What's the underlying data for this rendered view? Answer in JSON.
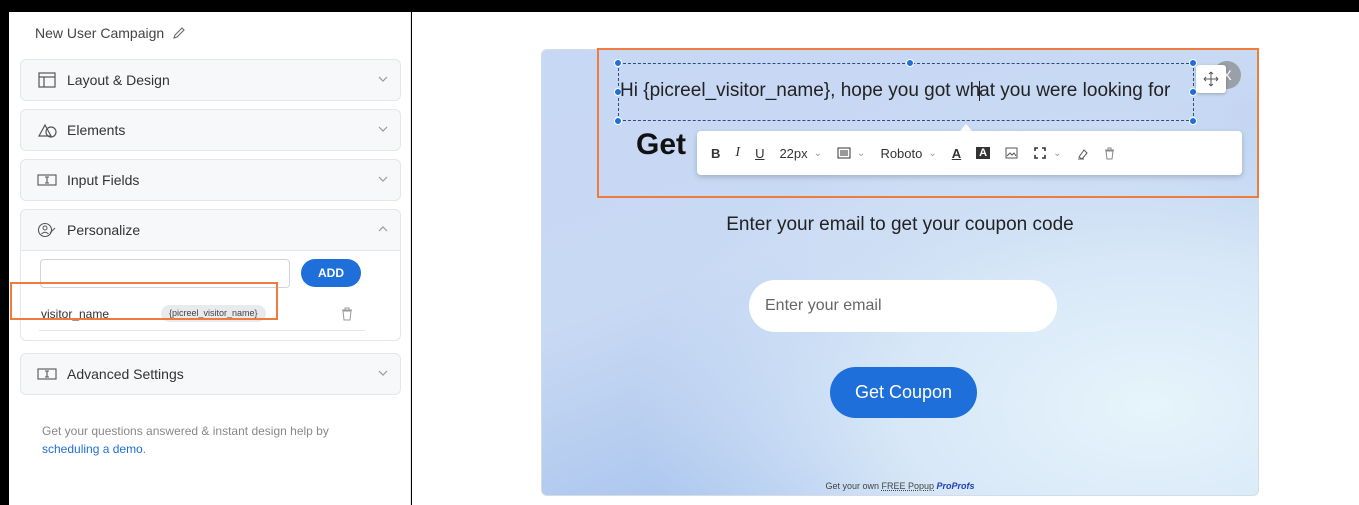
{
  "sidebar": {
    "campaign_title": "New User Campaign",
    "panels": [
      {
        "label": "Layout & Design",
        "icon": "layout-icon",
        "expanded": false
      },
      {
        "label": "Elements",
        "icon": "shapes-icon",
        "expanded": false
      },
      {
        "label": "Input Fields",
        "icon": "input-field-icon",
        "expanded": false
      },
      {
        "label": "Personalize",
        "icon": "personalize-icon",
        "expanded": true
      },
      {
        "label": "Advanced Settings",
        "icon": "settings-field-icon",
        "expanded": false
      }
    ],
    "personalize": {
      "input_value": "",
      "add_label": "ADD",
      "variable_name": "visitor_name",
      "variable_tag": "{picreel_visitor_name}"
    },
    "help_text": "Get your questions answered & instant design help by",
    "help_link": "scheduling a demo",
    "help_suffix": "."
  },
  "popup": {
    "heading_before_cursor": "Hi {picreel_visitor_name}, hope you got wh",
    "heading_after_cursor": "at you were looking for",
    "get_text": "Get",
    "close_label": "X",
    "subheading": "Enter your email to get your coupon code",
    "email_placeholder": "Enter your email",
    "button_label": "Get Coupon",
    "footer_text": "Get your own",
    "footer_free": "FREE Popup",
    "footer_brand": "ProProfs"
  },
  "toolbar": {
    "bold": "B",
    "italic": "I",
    "underline": "U",
    "font_size": "22px",
    "font_family": "Roboto",
    "text_color": "A",
    "highlight": "A"
  },
  "colors": {
    "accent": "#1e6fd9",
    "selection_orange": "#f07b3f"
  }
}
